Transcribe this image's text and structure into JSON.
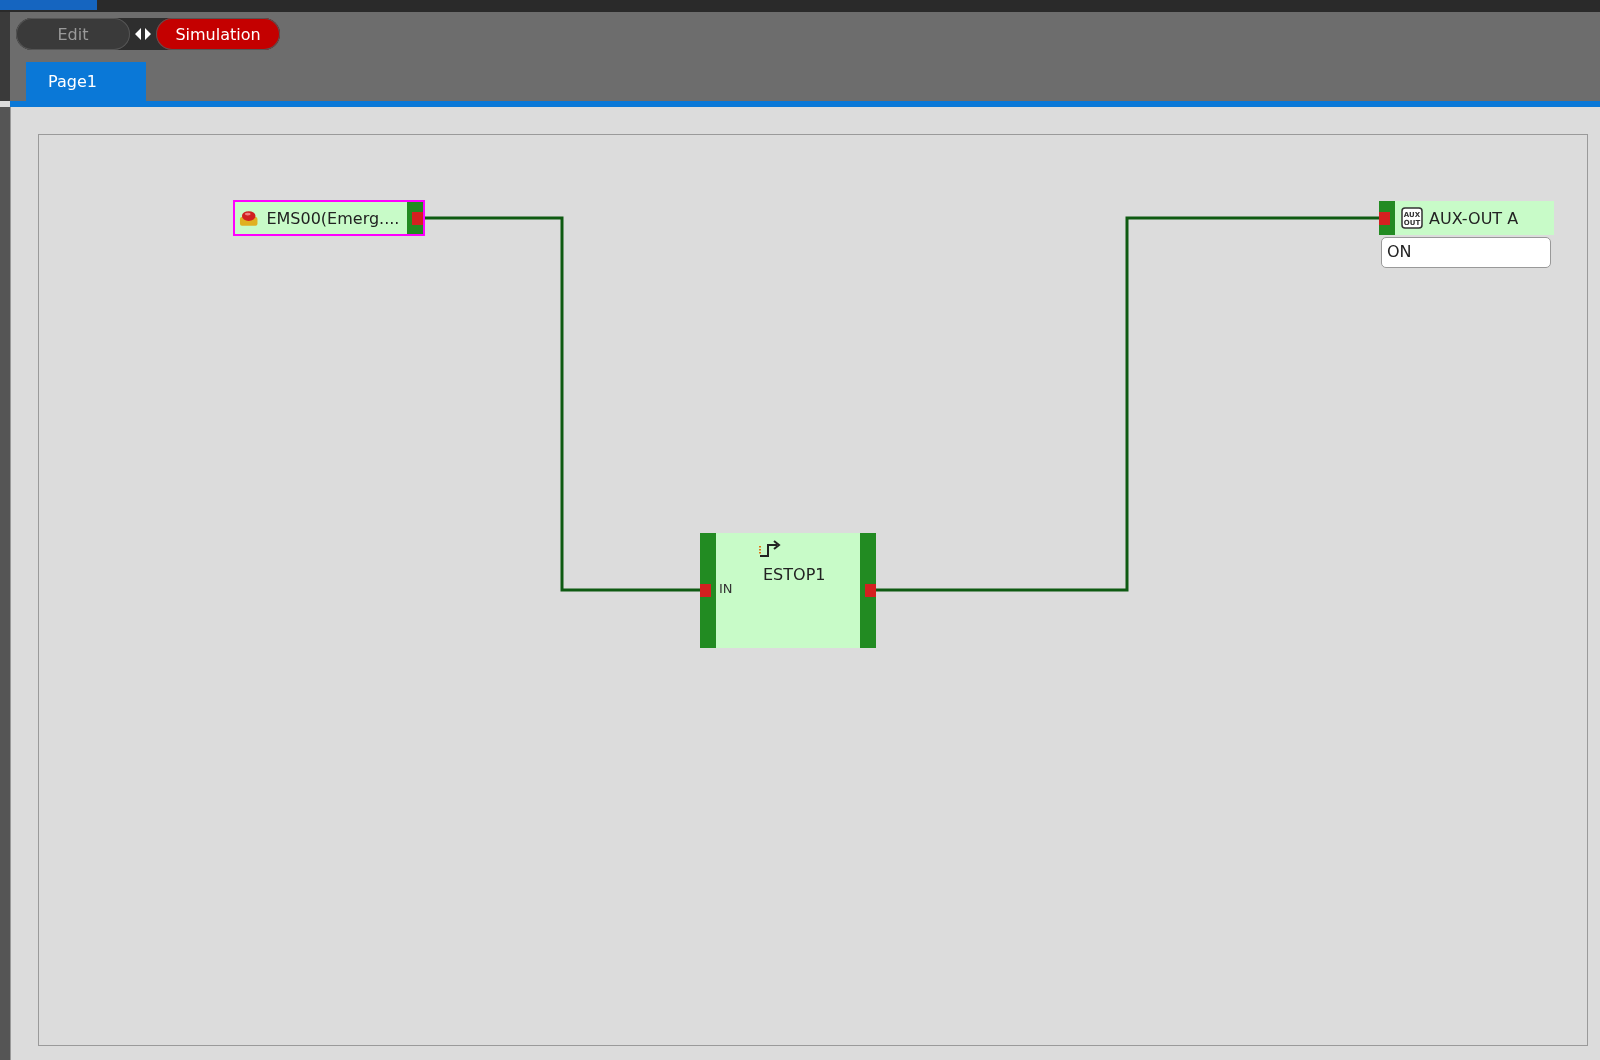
{
  "mode_switch": [
    {
      "label": "Edit",
      "selected": false
    },
    {
      "label": "Simulation",
      "selected": true
    }
  ],
  "tabs": [
    {
      "label": "Page1",
      "selected": true
    }
  ],
  "nodes": [
    {
      "kind": "input",
      "label": "EMS00(Emerg....",
      "selected": true
    },
    {
      "kind": "function",
      "label": "ESTOP1",
      "input_label": "IN",
      "selected": false
    },
    {
      "kind": "output",
      "label": "AUX-OUT A",
      "icon_text": [
        "AUX",
        "OUT"
      ],
      "value": "ON",
      "selected": false
    }
  ]
}
